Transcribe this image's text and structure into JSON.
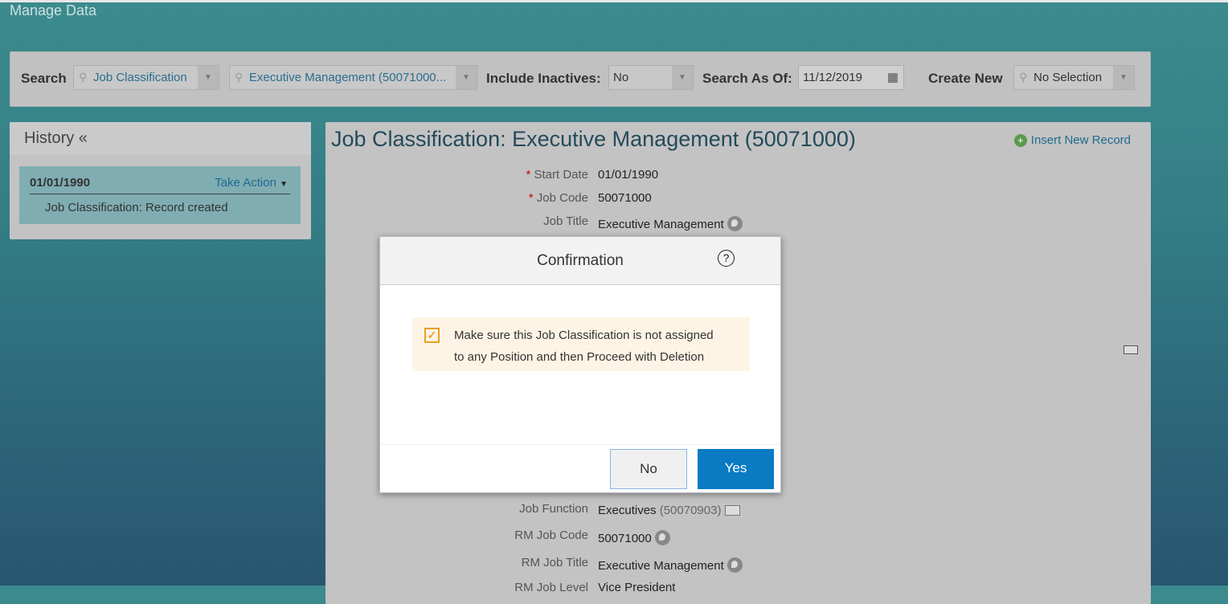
{
  "app_title": "Manage Data",
  "search": {
    "label": "Search",
    "object_type": "Job Classification",
    "record": "Executive Management (50071000...",
    "include_inactives_label": "Include Inactives:",
    "include_inactives_value": "No",
    "as_of_label": "Search As Of:",
    "as_of_value": "11/12/2019",
    "create_new_label": "Create New",
    "create_new_value": "No Selection"
  },
  "history": {
    "title": "History «",
    "item": {
      "date": "01/01/1990",
      "action": "Take Action",
      "description": "Job Classification: Record created"
    }
  },
  "record": {
    "title": "Job Classification: Executive Management (50071000)",
    "insert_label": "Insert New Record",
    "fields_top": [
      {
        "label": "Start Date",
        "value": "01/01/1990",
        "required": true
      },
      {
        "label": "Job Code",
        "value": "50071000",
        "required": true
      },
      {
        "label": "Job Title",
        "value": "Executive Management",
        "required": false
      }
    ],
    "job_function": {
      "label": "Job Function",
      "value": "Executives",
      "code": "(50070903)"
    },
    "rm_job_code": {
      "label": "RM Job Code",
      "value": "50071000"
    },
    "rm_job_title": {
      "label": "RM Job Title",
      "value": "Executive Management"
    },
    "rm_job_level": {
      "label": "RM Job Level",
      "value": "Vice President"
    }
  },
  "dialog": {
    "title": "Confirmation",
    "help": "?",
    "message_line1": "Make sure this Job Classification is not assigned",
    "message_line2": "to any Position and then Proceed with Deletion",
    "no_label": "No",
    "yes_label": "Yes"
  },
  "colors": {
    "accent": "#0a7ac2",
    "link": "#2a6d8f",
    "warning": "#e9a024"
  }
}
